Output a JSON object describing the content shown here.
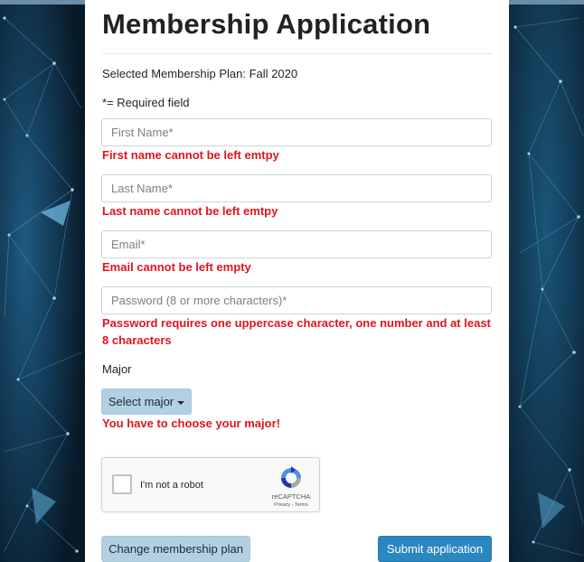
{
  "form": {
    "title": "Membership Application",
    "selected_plan": "Selected Membership Plan: Fall 2020",
    "required_note": "*= Required field",
    "first_name": {
      "placeholder": "First Name*",
      "value": "",
      "error": "First name cannot be left emtpy"
    },
    "last_name": {
      "placeholder": "Last Name*",
      "value": "",
      "error": "Last name cannot be left emtpy"
    },
    "email": {
      "placeholder": "Email*",
      "value": "",
      "error": "Email cannot be left empty"
    },
    "password": {
      "placeholder": "Password (8 or more characters)*",
      "value": "",
      "error": "Password requires one uppercase character, one number and at least 8 characters"
    },
    "major": {
      "label": "Major",
      "dropdown_label": "Select major",
      "error": "You have to choose your major!"
    },
    "recaptcha": {
      "label": "I'm not a robot",
      "brand": "reCAPTCHA",
      "links": "Privacy - Terms",
      "checked": false
    },
    "change_plan_button": "Change membership plan",
    "submit_button": "Submit application"
  },
  "colors": {
    "error": "#e0141e",
    "primary_button": "#2b87c0",
    "secondary_button": "#b1d1e1",
    "background": "#0b2234"
  },
  "icons": {
    "dropdown": "caret-down-icon",
    "recaptcha": "recaptcha-logo-icon"
  }
}
